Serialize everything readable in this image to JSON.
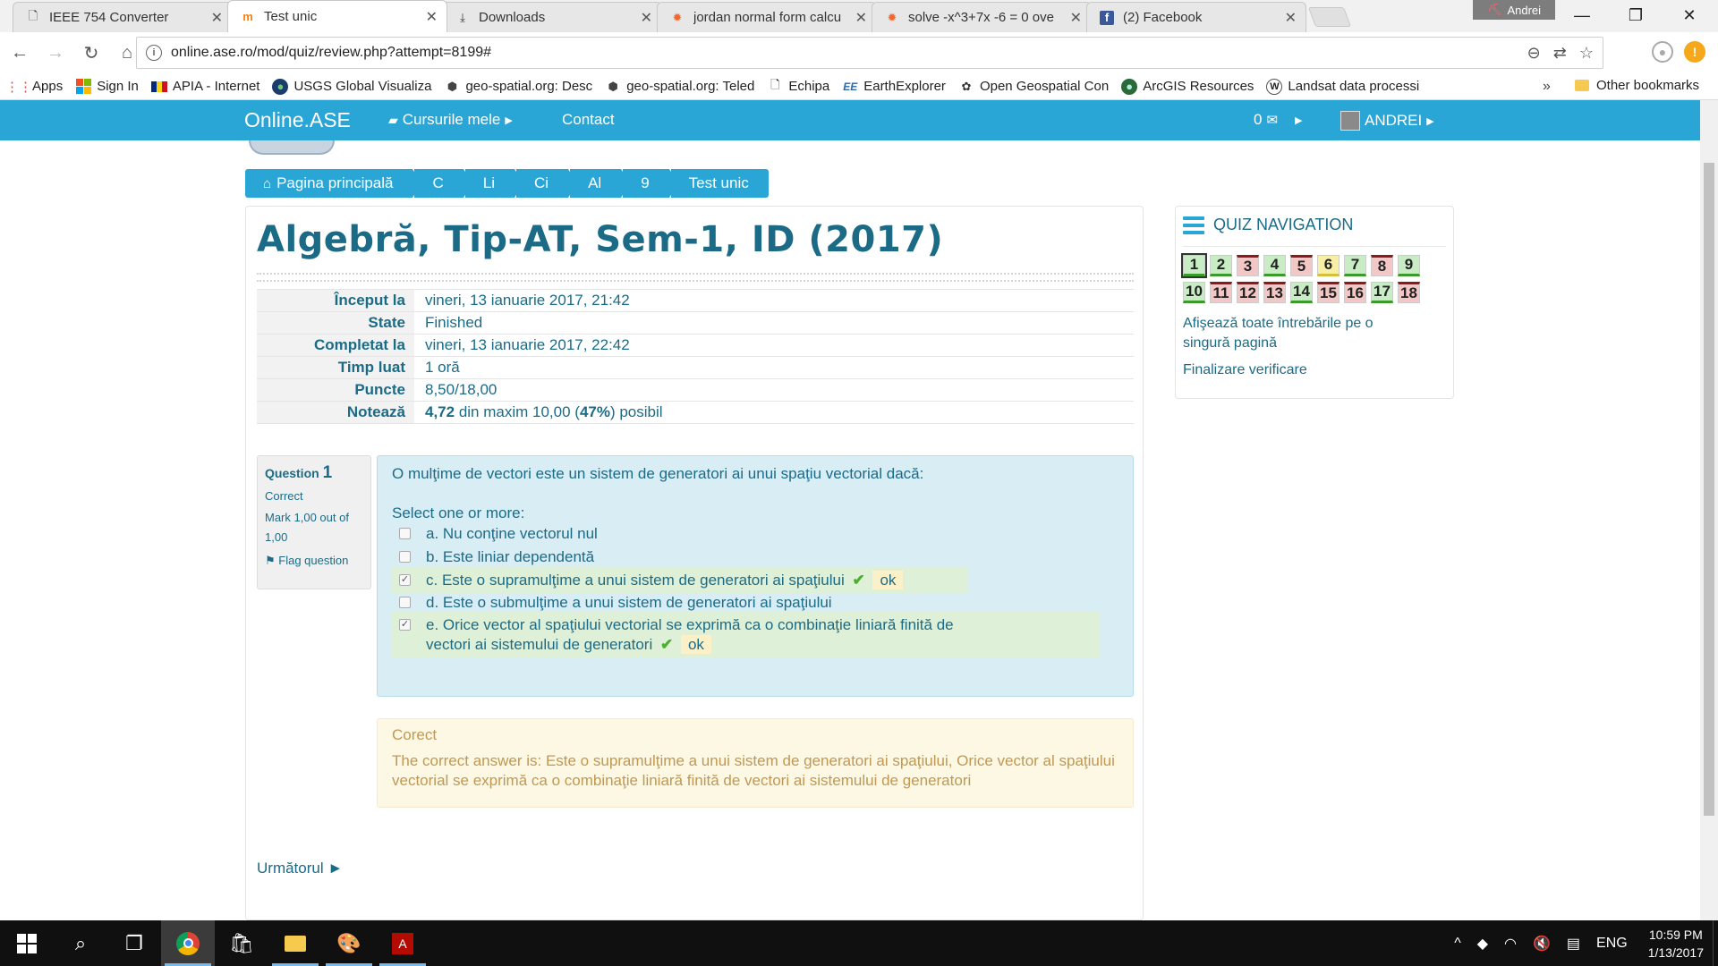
{
  "browser": {
    "tabs": [
      {
        "title": "IEEE 754 Converter",
        "icon": "page-icon",
        "active": false
      },
      {
        "title": "Test unic",
        "icon": "moodle-icon",
        "active": true
      },
      {
        "title": "Downloads",
        "icon": "download-icon",
        "active": false
      },
      {
        "title": "jordan normal form calcu",
        "icon": "wolfram-icon",
        "active": false
      },
      {
        "title": "solve -x^3+7x -6 = 0 ove",
        "icon": "wolfram-icon",
        "active": false
      },
      {
        "title": "(2) Facebook",
        "icon": "facebook-icon",
        "active": false
      }
    ],
    "profile_name": "Andrei",
    "url": "online.ase.ro/mod/quiz/review.php?attempt=8199#",
    "bookmarks": [
      {
        "label": "Apps",
        "icon": "apps-grid-icon"
      },
      {
        "label": "Sign In",
        "icon": "windows-logo-icon"
      },
      {
        "label": "APIA - Internet",
        "icon": "romania-flag-icon"
      },
      {
        "label": "USGS Global Visualiza",
        "icon": "globe-icon"
      },
      {
        "label": "geo-spatial.org: Desc",
        "icon": "geo-spatial-icon"
      },
      {
        "label": "geo-spatial.org: Teled",
        "icon": "geo-spatial-icon"
      },
      {
        "label": "Echipa",
        "icon": "page-icon"
      },
      {
        "label": "EarthExplorer",
        "icon": "ee-logo-icon"
      },
      {
        "label": "Open Geospatial Con",
        "icon": "ogc-icon"
      },
      {
        "label": "ArcGIS Resources",
        "icon": "globe-icon"
      },
      {
        "label": "Landsat data processi",
        "icon": "wordpress-icon"
      }
    ],
    "bookmarks_more": "»",
    "other_bookmarks": "Other bookmarks"
  },
  "site": {
    "brand": "Online.ASE",
    "nav": {
      "courses": "Cursurile mele",
      "contact": "Contact",
      "messages_count": "0",
      "user": "ANDREI"
    },
    "breadcrumb": [
      "Pagina principală",
      "C",
      "Li",
      "Ci",
      "Al",
      "9",
      "Test unic"
    ]
  },
  "quiz": {
    "title": "Algebră, Tip-AT, Sem-1, ID (2017)",
    "summary": [
      {
        "label": "Început la",
        "value": "vineri, 13 ianuarie 2017, 21:42"
      },
      {
        "label": "State",
        "value": "Finished"
      },
      {
        "label": "Completat la",
        "value": "vineri, 13 ianuarie 2017, 22:42"
      },
      {
        "label": "Timp luat",
        "value": "1 oră"
      },
      {
        "label": "Puncte",
        "value": "8,50/18,00"
      }
    ],
    "grade": {
      "label": "Notează",
      "value": "4,72",
      "mid": " din maxim 10,00 (",
      "percent": "47%",
      "tail": ") posibil"
    },
    "question": {
      "label": "Question",
      "number": "1",
      "status": "Correct",
      "mark": "Mark 1,00 out of 1,00",
      "flag": "Flag question",
      "text": "O mulţime de vectori este un sistem de generatori ai unui spaţiu vectorial dacă:",
      "prompt": "Select one or more:",
      "answers": [
        {
          "text": "a. Nu conţine vectorul nul",
          "checked": false,
          "correct": false
        },
        {
          "text": "b. Este liniar dependentă",
          "checked": false,
          "correct": false
        },
        {
          "text": "c. Este o supramulţime a unui sistem de generatori ai spaţiului",
          "checked": true,
          "correct": true
        },
        {
          "text": "d. Este o submulţime a unui sistem de generatori ai spaţiului",
          "checked": false,
          "correct": false
        },
        {
          "text": "e. Orice vector al spaţiului vectorial se exprimă ca o combinaţie liniară finită de vectori ai sistemului de generatori",
          "checked": true,
          "correct": true
        }
      ],
      "ok_label": "ok"
    },
    "feedback": {
      "title": "Corect",
      "body": "The correct answer is: Este o supramulţime a unui sistem de generatori ai spaţiului, Orice vector al spaţiului vectorial se exprimă ca o combinaţie liniară finită de vectori ai sistemului de generatori"
    },
    "next_label": "Următorul ►"
  },
  "quiz_nav": {
    "title": "QUIZ NAVIGATION",
    "questions": [
      {
        "n": "1",
        "state": "correct",
        "current": true
      },
      {
        "n": "2",
        "state": "correct"
      },
      {
        "n": "3",
        "state": "wrong"
      },
      {
        "n": "4",
        "state": "correct"
      },
      {
        "n": "5",
        "state": "wrong"
      },
      {
        "n": "6",
        "state": "partial"
      },
      {
        "n": "7",
        "state": "correct"
      },
      {
        "n": "8",
        "state": "wrong"
      },
      {
        "n": "9",
        "state": "correct"
      },
      {
        "n": "10",
        "state": "correct"
      },
      {
        "n": "11",
        "state": "wrong"
      },
      {
        "n": "12",
        "state": "wrong"
      },
      {
        "n": "13",
        "state": "wrong"
      },
      {
        "n": "14",
        "state": "correct"
      },
      {
        "n": "15",
        "state": "wrong"
      },
      {
        "n": "16",
        "state": "wrong"
      },
      {
        "n": "17",
        "state": "correct"
      },
      {
        "n": "18",
        "state": "wrong"
      }
    ],
    "show_all": "Afişează toate întrebările pe o singură pagină",
    "finish": "Finalizare verificare"
  },
  "taskbar": {
    "language": "ENG",
    "time": "10:59 PM",
    "date": "1/13/2017"
  },
  "colors": {
    "brand_blue": "#29a6d6",
    "text_teal": "#1b6b87",
    "correct_green": "#dff0d8",
    "feedback_yellow": "#fcf8e3"
  }
}
